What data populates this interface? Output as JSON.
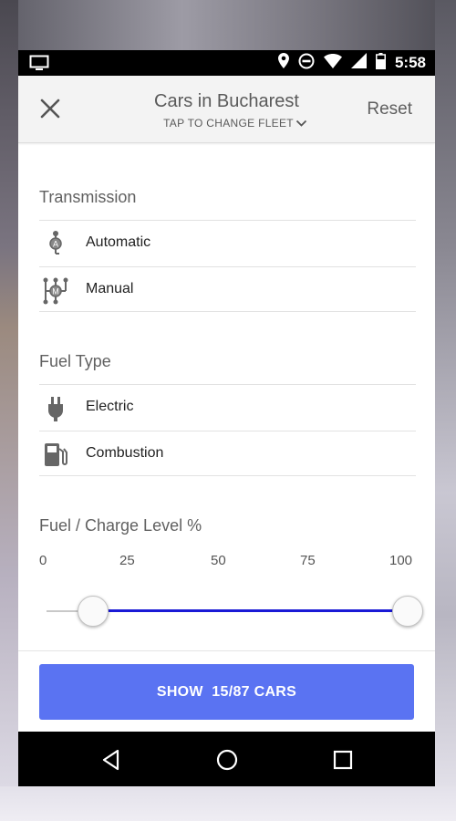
{
  "status_bar": {
    "time": "5:58",
    "icons": [
      "monitor-icon",
      "location-icon",
      "do-not-disturb-icon",
      "wifi-icon",
      "signal-icon",
      "battery-icon"
    ]
  },
  "header": {
    "title": "Cars in Bucharest",
    "subtitle": "TAP TO CHANGE FLEET",
    "reset_label": "Reset",
    "close_icon": "close-icon"
  },
  "transmission": {
    "title": "Transmission",
    "options": [
      {
        "label": "Automatic",
        "icon": "automatic-gear-icon"
      },
      {
        "label": "Manual",
        "icon": "manual-gear-icon"
      }
    ]
  },
  "fuel_type": {
    "title": "Fuel Type",
    "options": [
      {
        "label": "Electric",
        "icon": "plug-icon"
      },
      {
        "label": "Combustion",
        "icon": "fuel-pump-icon"
      }
    ]
  },
  "fuel_level": {
    "title": "Fuel / Charge Level %",
    "ticks": [
      "0",
      "25",
      "50",
      "75",
      "100"
    ],
    "range_min": 13,
    "range_max": 100
  },
  "show_button": {
    "label": "SHOW  15/87 CARS"
  },
  "colors": {
    "accent": "#5a73f2",
    "slider_fill": "#1a1ad6",
    "header_bg": "#f3f3f3"
  }
}
